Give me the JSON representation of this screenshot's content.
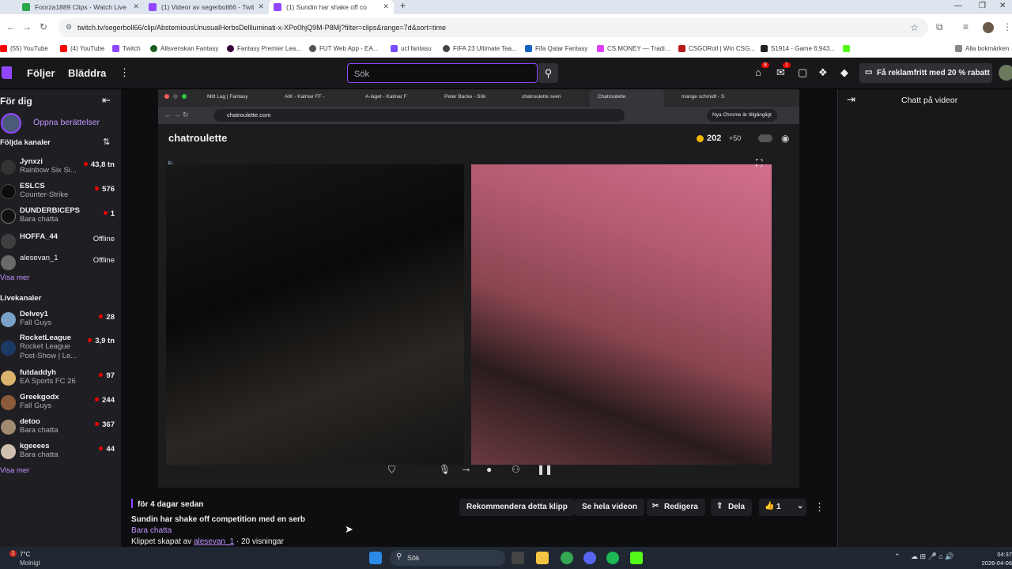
{
  "browser": {
    "tabs": [
      {
        "title": "Foorza1889 Clips - Watch Live",
        "color": "#2ba84a"
      },
      {
        "title": "(1) Videor av segerboll66 - Twit",
        "color": "#9147ff"
      },
      {
        "title": "(1) Sundin har shake off co",
        "color": "#9147ff"
      }
    ],
    "new_tab": "+",
    "url": "twitch.tv/segerboll66/clip/AbstemiousUnusualHerbsDellluminati-x-XPo0hjQ9M-P8Mj?filter=clips&range=7d&sort=time",
    "bookmarks": [
      "(55) YouTube",
      "(4) YouTube",
      "Twitch",
      "Allsvenskan Fantasy",
      "Fantasy Premier Lea...",
      "FUT Web App - EA...",
      "ucl fantasu",
      "FIFA 23 Ultimate Tea...",
      "Fifa Qatar Fantasy",
      "CS.MONEY — Tradi...",
      "CSGORoll | Win CSG...",
      "S1914 - Game 6,943..."
    ],
    "all_bookmarks": "Alla bokmärken"
  },
  "twitch_nav": {
    "following": "Följer",
    "browse": "Bläddra",
    "search_placeholder": "Sök",
    "promo": "Få reklamfritt med 20 % rabatt",
    "badge_inbox": "8",
    "badge_notif": "1"
  },
  "sidebar": {
    "header": "För dig",
    "stories": "Öppna berättelser",
    "followed_title": "Följda kanaler",
    "followed": [
      {
        "name": "Jynxzi",
        "game": "Rainbow Six Si...",
        "viewers": "43,8 tn",
        "live": true
      },
      {
        "name": "ESLCS",
        "game": "Counter-Strike",
        "viewers": "576",
        "live": true
      },
      {
        "name": "DUNDERBICEPS",
        "game": "Bara chatta",
        "viewers": "1",
        "live": true
      },
      {
        "name": "HOFFA_44",
        "game": "",
        "viewers": "Offline",
        "live": false
      },
      {
        "name": "alesevan_1",
        "game": "",
        "viewers": "Offline",
        "live": false
      }
    ],
    "show_more_1": "Visa mer",
    "live_title": "Livekanaler",
    "live": [
      {
        "name": "Delvey1",
        "game": "Fall Guys",
        "viewers": "28"
      },
      {
        "name": "RocketLeague",
        "game": "Rocket League",
        "game2": "Post-Show | Le...",
        "viewers": "3,9 tn"
      },
      {
        "name": "futdaddyh",
        "game": "EA Sports FC 26",
        "viewers": "97"
      },
      {
        "name": "Greekgodx",
        "game": "Fall Guys",
        "viewers": "244"
      },
      {
        "name": "detoo",
        "game": "Bara chatta",
        "viewers": "367"
      },
      {
        "name": "kgeeees",
        "game": "Bara chatta",
        "viewers": "44"
      }
    ],
    "show_more_2": "Visa mer"
  },
  "video": {
    "inner_tabs": [
      "Mitt Lag | Fantasy",
      "AIK - Kalmar FF -",
      "A-laget - Kalmar F",
      "Peter Backe - Sök",
      "chatroulette sveri",
      "Chatroulette",
      "mange schmidt - S"
    ],
    "inner_url": "chatroulette.com",
    "inner_chrome_notice": "Nya Chrome är tillgängligt",
    "site_logo": "chatroulette",
    "coins": "202",
    "coins_bonus": "+50"
  },
  "clip": {
    "age": "för 4 dagar sedan",
    "title": "Sundin har shake off competition med en serb",
    "category": "Bara chatta",
    "created_by_prefix": "Klippet skapat av",
    "creator": "alesevan_1",
    "views": "· 20 visningar",
    "actions": {
      "recommend": "Rekommendera detta klipp",
      "full_video": "Se hela videon",
      "edit": "Redigera",
      "share": "Dela",
      "likes": "1"
    }
  },
  "chat": {
    "title": "Chatt på videor"
  },
  "taskbar": {
    "weather_temp": "7°C",
    "weather_desc": "Molnigt",
    "search": "Sök",
    "time": "04:37",
    "date": "2026-04-06",
    "notif": "1"
  }
}
